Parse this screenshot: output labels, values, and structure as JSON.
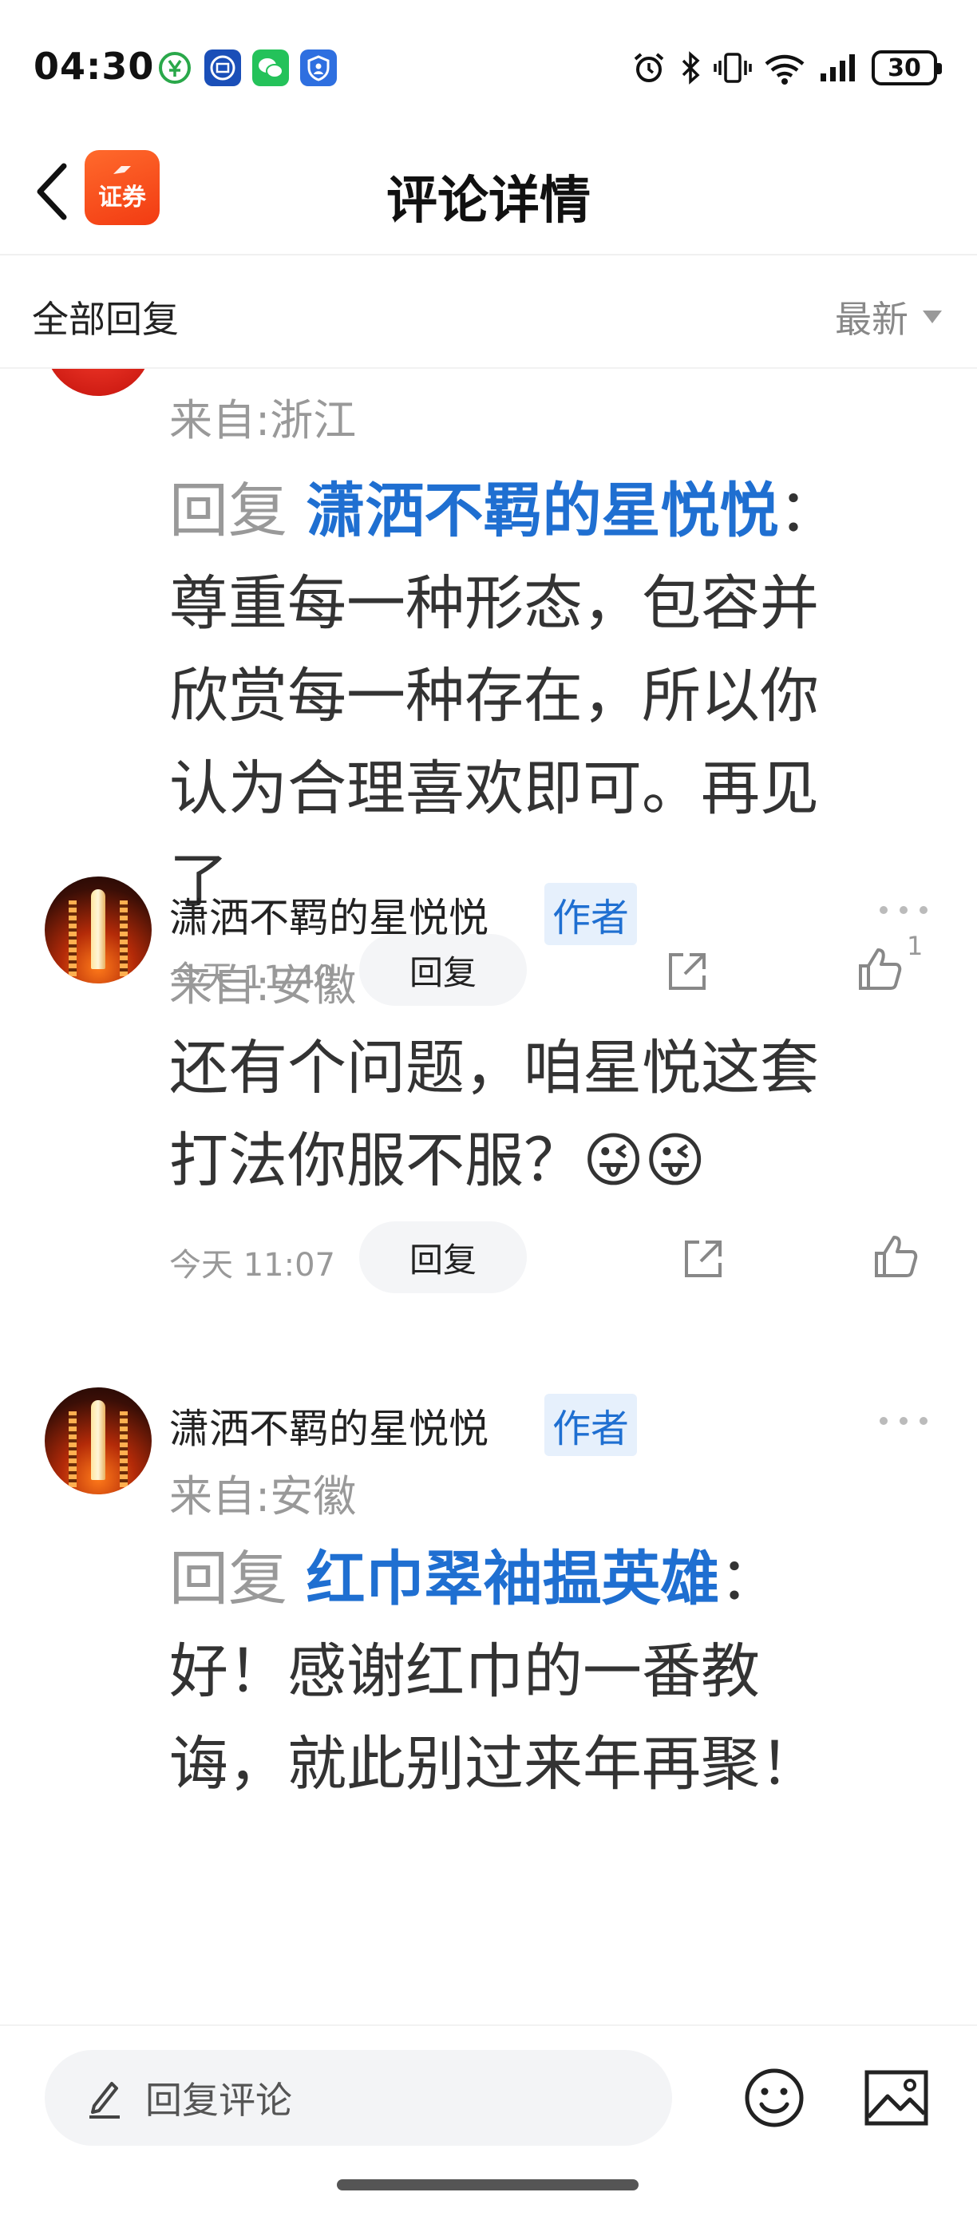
{
  "status_bar": {
    "time": "04:30",
    "battery": "30"
  },
  "header": {
    "title": "评论详情",
    "app_logo_text": "证券"
  },
  "sort_bar": {
    "label": "全部回复",
    "sort_value": "最新"
  },
  "comments": [
    {
      "location": "来自:浙江",
      "reply_prefix": "回复",
      "reply_target": "潇洒不羁的星悦悦",
      "reply_colon": "：",
      "text_lines": [
        "尊重每一种形态，包容并",
        "欣赏每一种存在，所以你",
        "认为合理喜欢即可。再见",
        "了"
      ],
      "time": "今天 11:40",
      "reply_label": "回复",
      "like_count": "1"
    },
    {
      "username": "潇洒不羁的星悦悦",
      "author_tag": "作者",
      "location": "来自:安徽",
      "text_lines": [
        "还有个问题，咱星悦这套",
        "打法你服不服？😜😜"
      ],
      "time": "今天 11:07",
      "reply_label": "回复"
    },
    {
      "username": "潇洒不羁的星悦悦",
      "author_tag": "作者",
      "location": "来自:安徽",
      "reply_prefix": "回复",
      "reply_target": "红巾翠袖揾英雄",
      "reply_colon": "：",
      "text_lines": [
        "好！感谢红巾的一番教",
        "诲，就此别过来年再聚！"
      ]
    }
  ],
  "bottom_bar": {
    "input_placeholder": "回复评论"
  },
  "colors": {
    "link_blue": "#1f6fd1",
    "brand_orange": "#f23b12",
    "muted_gray": "#999999"
  },
  "icons": [
    "back-arrow-icon",
    "pencil-icon",
    "emoji-icon",
    "image-icon",
    "share-icon",
    "thumbs-up-icon",
    "more-dots-icon",
    "alarm-icon",
    "bluetooth-icon",
    "vibrate-icon",
    "wifi-icon",
    "signal-icon"
  ]
}
